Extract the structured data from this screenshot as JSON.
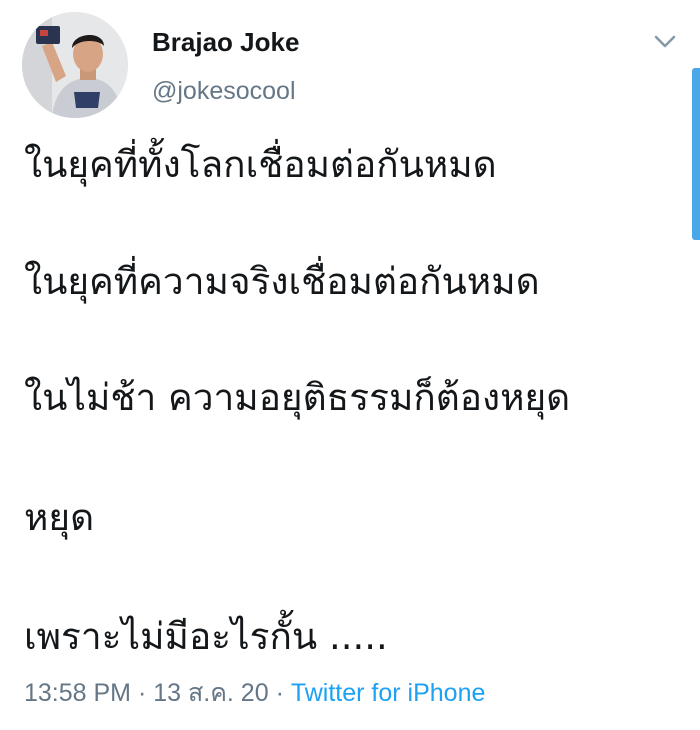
{
  "tweet": {
    "author": {
      "display_name": "Brajao Joke",
      "handle": "@jokesocool",
      "avatar_icon": "profile-photo"
    },
    "menu_icon": "chevron-down-icon",
    "lines": [
      "ในยุคที่ทั้งโลกเชื่อมต่อกันหมด",
      "ในยุคที่ความจริงเชื่อมต่อกันหมด",
      "ในไม่ช้า ความอยุติธรรมก็ต้องหยุด",
      "หยุด",
      "เพราะไม่มีอะไรกั้น ....."
    ],
    "meta": {
      "time": "13:58 PM",
      "separator": " · ",
      "date": "13 ส.ค. 20",
      "source": "Twitter for iPhone"
    }
  },
  "colors": {
    "text": "#14171a",
    "secondary": "#657786",
    "link": "#1da1f2",
    "scroll_indicator": "#4aa8e8"
  }
}
